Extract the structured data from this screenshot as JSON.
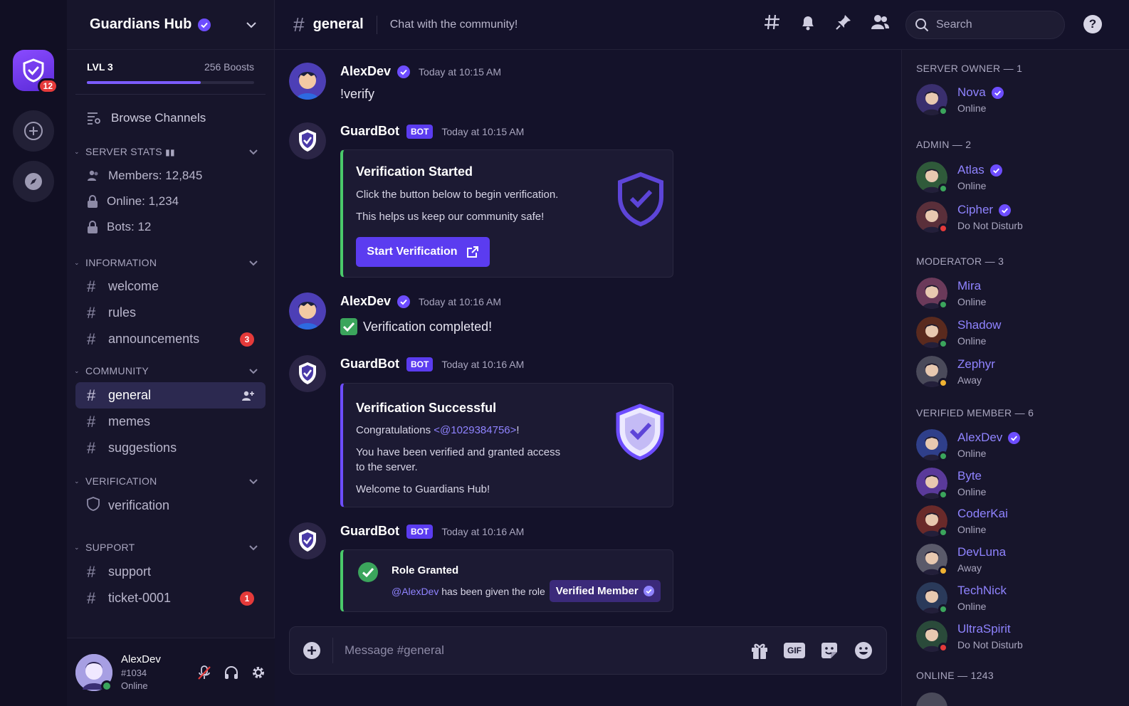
{
  "window": {
    "dots": [
      "#ff5f57",
      "#febc2e",
      "#28c840"
    ]
  },
  "rail": {
    "server_badge": "12"
  },
  "server": {
    "name": "Guardians Hub",
    "level": "LVL 3",
    "boosts": "256 Boosts",
    "boost_progress": 0.68
  },
  "sidebar": {
    "browse_label": "Browse Channels",
    "stats_category": "SERVER STATS",
    "stats": [
      "Members: 12,845",
      "Online: 1,234",
      "Bots: 12"
    ],
    "categories": [
      {
        "name": "INFORMATION",
        "channels": [
          {
            "name": "welcome",
            "count": ""
          },
          {
            "name": "rules",
            "count": ""
          },
          {
            "name": "announcements",
            "count": "3"
          }
        ]
      },
      {
        "name": "COMMUNITY",
        "channels": [
          {
            "name": "general",
            "count": ""
          },
          {
            "name": "memes",
            "count": ""
          },
          {
            "name": "suggestions",
            "count": ""
          }
        ]
      },
      {
        "name": "VERIFICATION",
        "channels": [
          {
            "name": "verification",
            "count": ""
          }
        ]
      },
      {
        "name": "SUPPORT",
        "channels": [
          {
            "name": "support",
            "count": ""
          },
          {
            "name": "ticket-0001",
            "count": "1"
          }
        ]
      }
    ]
  },
  "user": {
    "name": "AlexDev",
    "tag": "#1034",
    "status": "Online"
  },
  "topbar": {
    "channel": "general",
    "topic": "Chat with the community!",
    "search_placeholder": "Search"
  },
  "messages": [
    {
      "author": "AlexDev",
      "time": "Today at 10:15 AM",
      "text": "!verify"
    },
    {
      "author": "GuardBot",
      "bot_tag": "BOT",
      "time": "Today at 10:15 AM",
      "embed": {
        "title": "Verification Started",
        "line1": "Click the button below to begin verification.",
        "line2": "This helps us keep our community safe!",
        "button": "Start Verification"
      }
    },
    {
      "author": "AlexDev",
      "time": "Today at 10:16 AM",
      "text": "Verification completed!"
    },
    {
      "author": "GuardBot",
      "bot_tag": "BOT",
      "time": "Today at 10:16 AM",
      "embed": {
        "title": "Verification Successful",
        "congrats": "Congratulations ",
        "mention": "<@1029384756>",
        "congrats_end": "!",
        "line2a": "You have been verified and granted access",
        "line2b": "to the server.",
        "line3": "Welcome to Guardians Hub!"
      }
    },
    {
      "author": "GuardBot",
      "bot_tag": "BOT",
      "time": "Today at 10:16 AM",
      "embed": {
        "title": "Role Granted",
        "mention": "@AlexDev",
        "text": " has been given the role",
        "role": "Verified Member"
      }
    }
  ],
  "composer": {
    "placeholder": "Message #general",
    "gif_label": "GIF"
  },
  "members": {
    "groups": [
      {
        "label": "SERVER OWNER — 1",
        "members": [
          {
            "name": "Nova",
            "status": "Online",
            "verified": true
          }
        ]
      },
      {
        "label": "ADMIN — 2",
        "members": [
          {
            "name": "Atlas",
            "status": "Online",
            "verified": true
          },
          {
            "name": "Cipher",
            "status": "Do Not Disturb",
            "verified": true
          }
        ]
      },
      {
        "label": "MODERATOR — 3",
        "members": [
          {
            "name": "Mira",
            "status": "Online"
          },
          {
            "name": "Shadow",
            "status": "Online"
          },
          {
            "name": "Zephyr",
            "status": "Away"
          }
        ]
      },
      {
        "label": "VERIFIED MEMBER — 6",
        "members": [
          {
            "name": "AlexDev",
            "status": "Online",
            "verified": true
          },
          {
            "name": "Byte",
            "status": "Online"
          },
          {
            "name": "CoderKai",
            "status": "Online"
          },
          {
            "name": "DevLuna",
            "status": "Away"
          },
          {
            "name": "TechNick",
            "status": "Online"
          },
          {
            "name": "UltraSpirit",
            "status": "Do Not Disturb"
          }
        ]
      },
      {
        "label": "ONLINE — 1243",
        "members": []
      }
    ]
  },
  "colors": {
    "accent": "#5b3cf0",
    "online": "#3ba55c",
    "away": "#f0b232",
    "dnd": "#e53a3a",
    "link": "#8f83ff"
  }
}
